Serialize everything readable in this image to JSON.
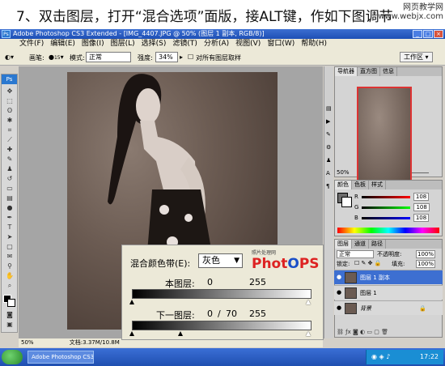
{
  "caption": {
    "text": "7、双击图层，打开“混合选项”面版，接ALT键，作如下图调节",
    "site_line1": "网页教学网",
    "site_line2": "www.webjx.com"
  },
  "window": {
    "title": "Adobe Photoshop CS3 Extended - [IMG_4407.JPG @ 50% (图层 1 副本, RGB/8)]",
    "app_badge": "Ps"
  },
  "menu": {
    "items": [
      "文件(F)",
      "编辑(E)",
      "图像(I)",
      "图层(L)",
      "选择(S)",
      "滤镜(T)",
      "分析(A)",
      "视图(V)",
      "窗口(W)",
      "帮助(H)"
    ]
  },
  "options": {
    "brush_label": "画笔:",
    "brush_size": "15",
    "mode_label": "模式:",
    "mode_value": "正常",
    "strength_label": "强度:",
    "strength_value": "34%",
    "sample_all_label": "对所有图层取样",
    "workspace_label": "工作区"
  },
  "toolbox": {
    "badge": "Ps"
  },
  "navigator": {
    "tabs": [
      "导航器",
      "直方图",
      "信息"
    ],
    "zoom": "50%"
  },
  "color_panel": {
    "tabs": [
      "颜色",
      "色板",
      "样式"
    ],
    "channels": [
      {
        "label": "R",
        "value": "108"
      },
      {
        "label": "G",
        "value": "108"
      },
      {
        "label": "B",
        "value": "108"
      }
    ]
  },
  "layers_panel": {
    "tabs": [
      "图层",
      "通道",
      "路径"
    ],
    "blend_mode": "正常",
    "opacity_label": "不透明度:",
    "opacity": "100%",
    "lock_label": "锁定:",
    "fill_label": "填充:",
    "fill": "100%",
    "layers": [
      {
        "name": "图层 1 副本",
        "selected": true
      },
      {
        "name": "图层 1",
        "selected": false
      },
      {
        "name": "背景",
        "selected": false
      }
    ]
  },
  "blend_dialog": {
    "band_label": "混合颜色带(E):",
    "band_value": "灰色",
    "this_layer_label": "本图层:",
    "this_layer_min": "0",
    "this_layer_max": "255",
    "underlying_label": "下一图层:",
    "underlying_min": "0",
    "underlying_mid": "70",
    "underlying_max": "255",
    "slash": "/",
    "logo_small": "照片处理网",
    "logo_pre": "Phot",
    "logo_o": "O",
    "logo_post": "PS"
  },
  "status": {
    "zoom": "50%",
    "doc": "文档:3.37M/10.8M"
  },
  "taskbar": {
    "task_label": "Adobe Photoshop CS3...",
    "time": "17:22"
  }
}
